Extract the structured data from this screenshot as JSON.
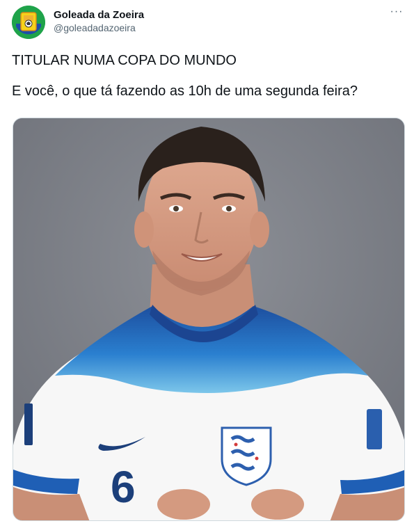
{
  "account": {
    "display_name": "Goleada da Zoeira",
    "handle": "@goleadadazoeira",
    "avatar_icon": "goleada-logo-icon"
  },
  "menu": {
    "more_label": "···"
  },
  "tweet": {
    "line1": "TITULAR NUMA COPA DO MUNDO",
    "line2": "E você, o que tá fazendo as 10h de uma segunda feira?"
  },
  "media": {
    "description_icon": "player-photo",
    "shirt_number": "6"
  },
  "colors": {
    "text": "#0f1419",
    "secondary": "#536471",
    "photo_background": "#7c7f86",
    "shirt_blue": "#1f5fb5"
  }
}
